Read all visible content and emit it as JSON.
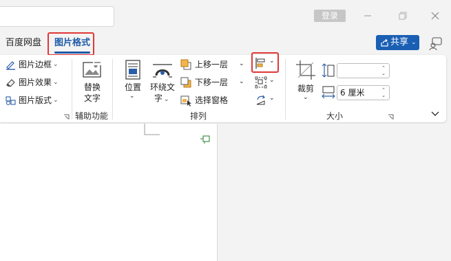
{
  "titlebar": {
    "login_label": "登录"
  },
  "tabs": [
    {
      "label": "百度网盘"
    },
    {
      "label": "图片格式"
    }
  ],
  "share": {
    "label": "共享"
  },
  "ribbon": {
    "picture_styles": {
      "items": [
        {
          "label": "图片边框"
        },
        {
          "label": "图片效果"
        },
        {
          "label": "图片版式"
        }
      ]
    },
    "accessibility": {
      "alt_text_line1": "替换",
      "alt_text_line2": "文字",
      "group_label": "辅助功能"
    },
    "arrange": {
      "position_label": "位置",
      "wrap_line1": "环绕文",
      "wrap_line2": "字",
      "bring_forward": "上移一层",
      "send_backward": "下移一层",
      "selection_pane": "选择窗格",
      "group_label": "排列"
    },
    "size": {
      "crop_label": "裁剪",
      "height_value": "",
      "width_value": "6 厘米",
      "group_label": "大小"
    }
  },
  "colors": {
    "accent": "#1e5aa8",
    "share_bg": "#1a5fb4",
    "highlight": "#e03636"
  }
}
